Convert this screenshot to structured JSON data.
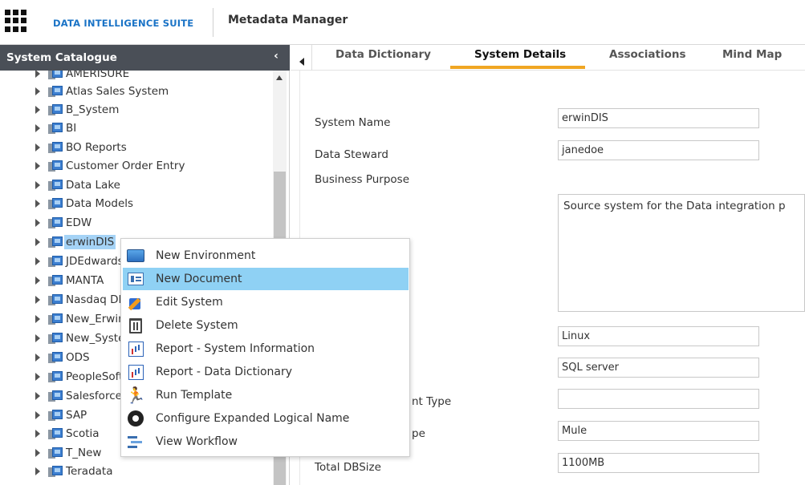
{
  "topbar": {
    "suite_name": "DATA INTELLIGENCE SUITE",
    "app_name": "Metadata Manager"
  },
  "catalogue": {
    "title": "System Catalogue",
    "collapse_icon": "chevron-left",
    "items": [
      {
        "label": "AMERISURE",
        "selected": false
      },
      {
        "label": "Atlas Sales System",
        "selected": false
      },
      {
        "label": "B_System",
        "selected": false
      },
      {
        "label": "BI",
        "selected": false
      },
      {
        "label": "BO Reports",
        "selected": false
      },
      {
        "label": "Customer Order Entry",
        "selected": false
      },
      {
        "label": "Data Lake",
        "selected": false
      },
      {
        "label": "Data Models",
        "selected": false
      },
      {
        "label": "EDW",
        "selected": false
      },
      {
        "label": "erwinDIS",
        "selected": true
      },
      {
        "label": "JDEdwards",
        "selected": false
      },
      {
        "label": "MANTA",
        "selected": false
      },
      {
        "label": "Nasdaq DB",
        "selected": false
      },
      {
        "label": "New_Erwin",
        "selected": false
      },
      {
        "label": "New_System",
        "selected": false
      },
      {
        "label": "ODS",
        "selected": false
      },
      {
        "label": "PeopleSoft",
        "selected": false
      },
      {
        "label": "Salesforce",
        "selected": false
      },
      {
        "label": "SAP",
        "selected": false
      },
      {
        "label": "Scotia",
        "selected": false
      },
      {
        "label": "T_New",
        "selected": false
      },
      {
        "label": "Teradata",
        "selected": false
      }
    ]
  },
  "tabs": [
    {
      "label": "Data Dictionary",
      "active": false
    },
    {
      "label": "System Details",
      "active": true
    },
    {
      "label": "Associations",
      "active": false
    },
    {
      "label": "Mind Map",
      "active": false
    }
  ],
  "accent_color": "#f0a623",
  "form": {
    "system_name": {
      "label": "System Name",
      "value": "erwinDIS"
    },
    "data_steward": {
      "label": "Data Steward",
      "value": "janedoe"
    },
    "business_purpose": {
      "label": "Business Purpose",
      "value": "Source system for the  Data integration p"
    },
    "os": {
      "value": "Linux"
    },
    "database": {
      "value": "SQL server"
    },
    "environment_type": {
      "label_visible": "nt Type",
      "value": ""
    },
    "type": {
      "label_visible": "pe",
      "value": "Mule"
    },
    "total_dbsize": {
      "label": "Total DBSize",
      "value": "1100MB"
    }
  },
  "context_menu": {
    "items": [
      {
        "label": "New Environment",
        "icon": "environment-icon",
        "highlighted": false
      },
      {
        "label": "New Document",
        "icon": "document-icon",
        "highlighted": true
      },
      {
        "label": "Edit System",
        "icon": "edit-icon",
        "highlighted": false
      },
      {
        "label": "Delete System",
        "icon": "trash-icon",
        "highlighted": false
      },
      {
        "label": "Report - System Information",
        "icon": "report-icon",
        "highlighted": false
      },
      {
        "label": "Report - Data Dictionary",
        "icon": "report-icon",
        "highlighted": false
      },
      {
        "label": "Run Template",
        "icon": "run-icon",
        "highlighted": false
      },
      {
        "label": "Configure Expanded Logical Name",
        "icon": "gear-icon",
        "highlighted": false
      },
      {
        "label": "View Workflow",
        "icon": "workflow-icon",
        "highlighted": false
      }
    ]
  }
}
